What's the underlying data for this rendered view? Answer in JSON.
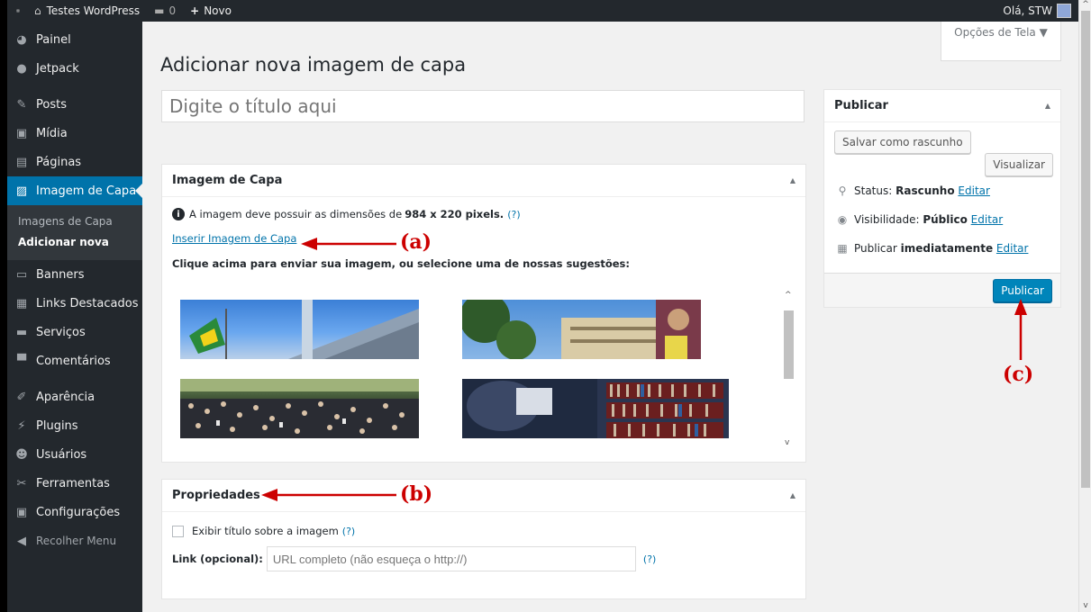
{
  "adminbar": {
    "site_name": "Testes WordPress",
    "comments_count": "0",
    "new_label": "Novo",
    "greeting": "Olá, STW"
  },
  "sidebar": {
    "items_top": [
      {
        "label": "Painel",
        "icon": "dashboard-icon",
        "glyph": "◕"
      },
      {
        "label": "Jetpack",
        "icon": "jetpack-icon",
        "glyph": "●"
      }
    ],
    "items_content": [
      {
        "label": "Posts",
        "icon": "pin-icon",
        "glyph": "✎"
      },
      {
        "label": "Mídia",
        "icon": "media-icon",
        "glyph": "▣"
      },
      {
        "label": "Páginas",
        "icon": "pages-icon",
        "glyph": "▤"
      }
    ],
    "active_item": {
      "label": "Imagem de Capa",
      "icon": "image-icon",
      "glyph": "▨"
    },
    "submenu": [
      "Imagens de Capa",
      "Adicionar nova"
    ],
    "items_after": [
      {
        "label": "Banners",
        "icon": "banners-icon",
        "glyph": "▭"
      },
      {
        "label": "Links Destacados",
        "icon": "links-icon",
        "glyph": "▦"
      },
      {
        "label": "Serviços",
        "icon": "folder-icon",
        "glyph": "▬"
      },
      {
        "label": "Comentários",
        "icon": "comment-icon",
        "glyph": "▀"
      }
    ],
    "items_bottom": [
      {
        "label": "Aparência",
        "icon": "appearance-icon",
        "glyph": "✐"
      },
      {
        "label": "Plugins",
        "icon": "plugins-icon",
        "glyph": "⚡"
      },
      {
        "label": "Usuários",
        "icon": "users-icon",
        "glyph": "☻"
      },
      {
        "label": "Ferramentas",
        "icon": "tools-icon",
        "glyph": "✂"
      },
      {
        "label": "Configurações",
        "icon": "settings-icon",
        "glyph": "▣"
      }
    ],
    "collapse_label": "Recolher Menu"
  },
  "main": {
    "screen_options": "Opções de Tela ▼",
    "page_title": "Adicionar nova imagem de capa",
    "title_placeholder": "Digite o título aqui"
  },
  "cover_box": {
    "title": "Imagem de Capa",
    "info_prefix": "A imagem deve possuir as dimensões de ",
    "info_dims": "984 x 220 pixels.",
    "help": "(?)",
    "insert_link": "Inserir Imagem de Capa",
    "instructions": "Clique acima para enviar sua imagem, ou selecione uma de nossas sugestões:"
  },
  "properties_box": {
    "title": "Propriedades",
    "show_title_label": "Exibir título sobre a imagem",
    "help": "(?)",
    "link_label": "Link (opcional):",
    "link_placeholder": "URL completo (não esqueça o http://)",
    "link_help": "(?)"
  },
  "publish_box": {
    "title": "Publicar",
    "save_draft": "Salvar como rascunho",
    "preview": "Visualizar",
    "status_label": "Status:",
    "status_value": "Rascunho",
    "visibility_label": "Visibilidade:",
    "visibility_value": "Público",
    "schedule_label": "Publicar",
    "schedule_value": "imediatamente",
    "edit": "Editar",
    "publish_button": "Publicar"
  },
  "annotations": {
    "a": "(a)",
    "b": "(b)",
    "c": "(c)"
  }
}
